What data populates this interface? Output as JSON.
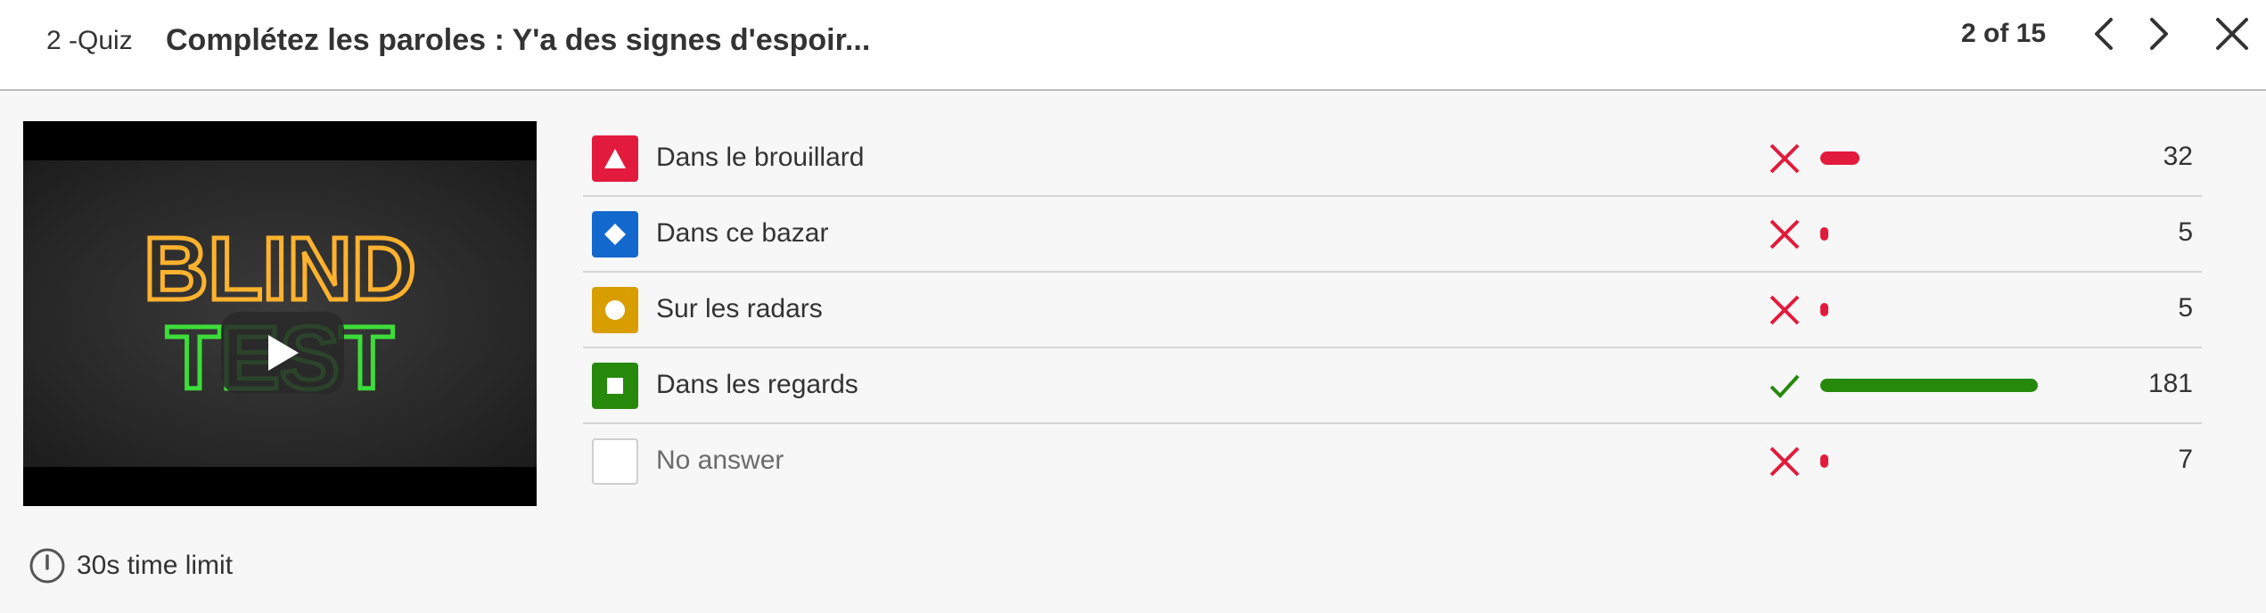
{
  "header": {
    "quiz_number": "2 -Quiz",
    "title": "Complétez les paroles : Y'a des signes d'espoir...",
    "pager": "2 of 15"
  },
  "video": {
    "thumbnail_text_line1": "BLIND",
    "thumbnail_text_line2": "TEST"
  },
  "answers": [
    {
      "label": "Dans le brouillard",
      "shape": "triangle-icon",
      "color": "#e21b3c",
      "correct": false,
      "count": "32"
    },
    {
      "label": "Dans ce bazar",
      "shape": "diamond-icon",
      "color": "#1368ce",
      "correct": false,
      "count": "5"
    },
    {
      "label": "Sur les radars",
      "shape": "circle-icon",
      "color": "#d89e00",
      "correct": false,
      "count": "5"
    },
    {
      "label": "Dans les regards",
      "shape": "square-icon",
      "color": "#26890c",
      "correct": true,
      "count": "181"
    },
    {
      "label": "No answer",
      "shape": "none",
      "color": "#ffffff",
      "correct": false,
      "count": "7"
    }
  ],
  "colors": {
    "wrong": "#e21b3c",
    "correct": "#26890c"
  },
  "footer": {
    "time_limit": "30s time limit"
  }
}
